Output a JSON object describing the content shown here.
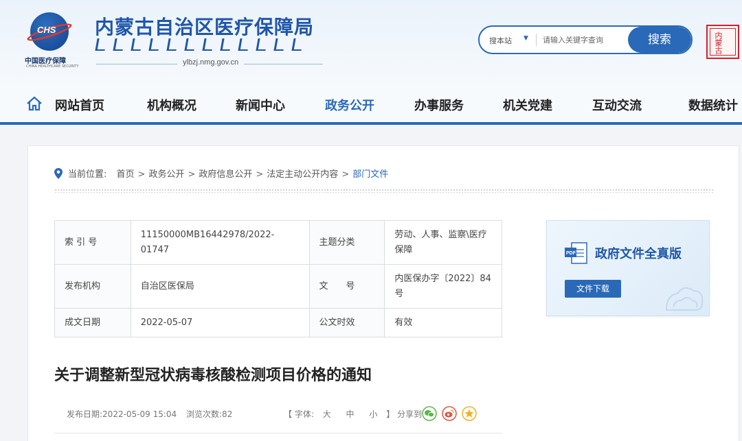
{
  "header": {
    "logo_text": "中国医疗保障",
    "logo_badge": "CHS",
    "logo_subtext": "CHINA HEALTHCARE SECURITY",
    "site_title": "内蒙古自治区医疗保障局",
    "domain": "ylbzj.nmg.gov.cn",
    "search": {
      "scope": "搜本站",
      "placeholder": "请输入关键字查询",
      "button": "搜索"
    },
    "seal_text": "内蒙古"
  },
  "nav": {
    "items": [
      {
        "label": "网站首页"
      },
      {
        "label": "机构概况"
      },
      {
        "label": "新闻中心"
      },
      {
        "label": "政务公开"
      },
      {
        "label": "办事服务"
      },
      {
        "label": "机关党建"
      },
      {
        "label": "互动交流"
      },
      {
        "label": "数据统计"
      }
    ],
    "active": "政务公开"
  },
  "breadcrumb": {
    "prefix": "当前位置:",
    "items": [
      "首页",
      "政务公开",
      "政府信息公开",
      "法定主动公开内容",
      "部门文件"
    ]
  },
  "meta": {
    "index_label": "索 引 号",
    "index_value": "11150000MB16442978/2022-01747",
    "topic_label": "主题分类",
    "topic_value": "劳动、人事、监察\\医疗保障",
    "publisher_label": "发布机构",
    "publisher_value": "自治区医保局",
    "docno_label": "文　　号",
    "docno_value": "内医保办字〔2022〕84号",
    "date_label": "成文日期",
    "date_value": "2022-05-07",
    "validity_label": "公文时效",
    "validity_value": "有效"
  },
  "article": {
    "title": "关于调整新型冠状病毒核酸检测项目价格的通知",
    "publish_date": "发布日期:2022-05-09 15:04",
    "views": "浏览次数:82",
    "font_label": "【 字体:",
    "font_large": "大",
    "font_medium": "中",
    "font_small": "小",
    "font_close": "】",
    "share_label": "分享到:"
  },
  "sidebox": {
    "title": "政府文件全真版",
    "download": "文件下载"
  },
  "colors": {
    "brand_blue": "#2a69b8",
    "title_blue": "#1f56a8",
    "seal_red": "#d0202a"
  }
}
